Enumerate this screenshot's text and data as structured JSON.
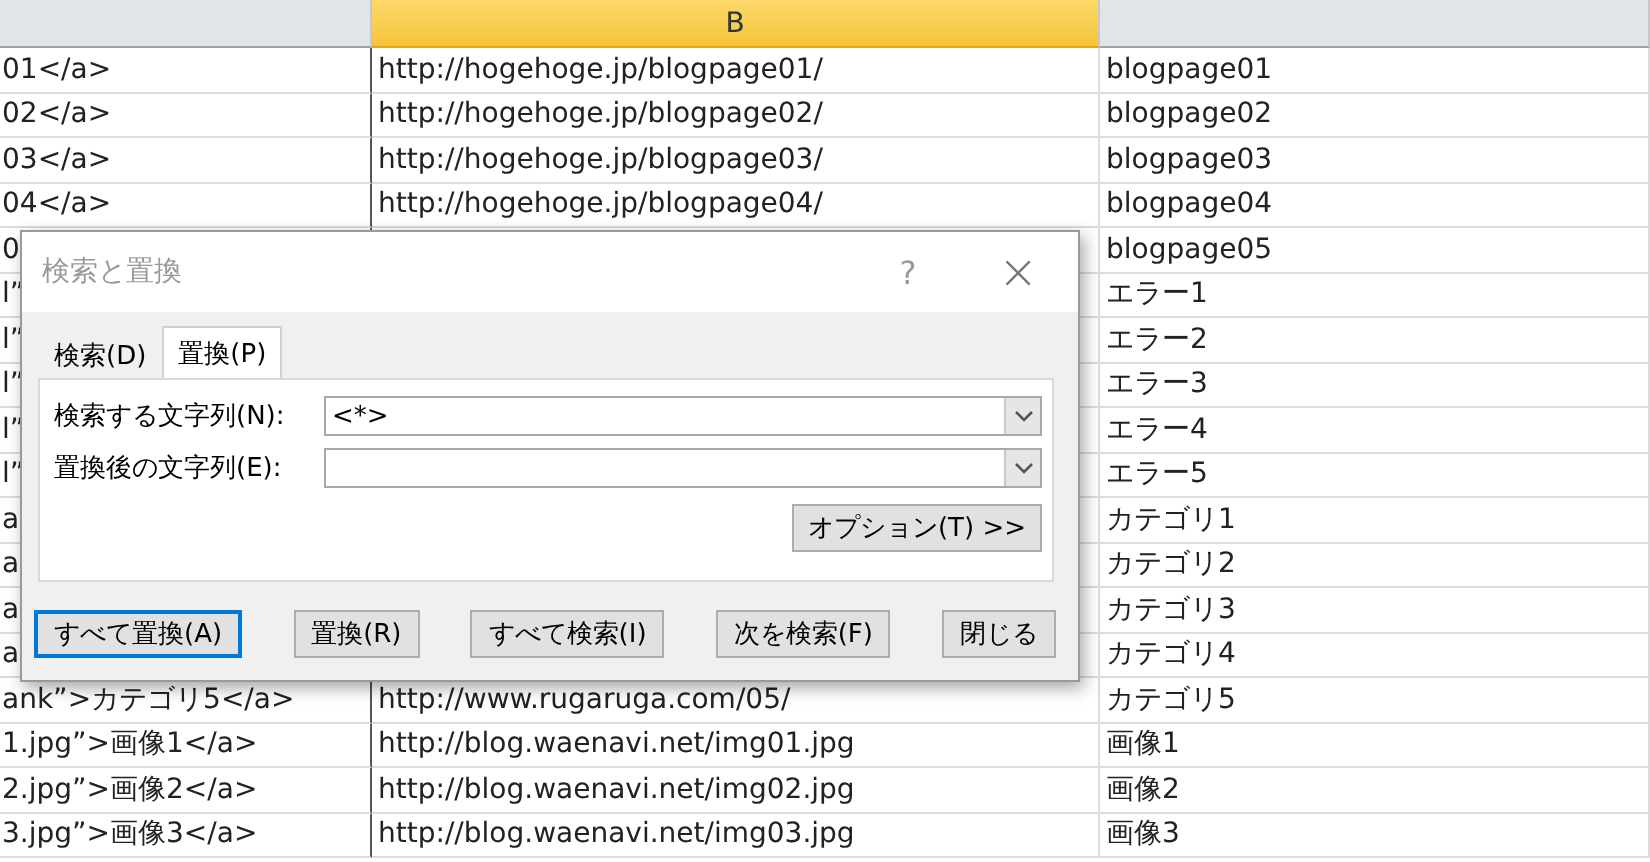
{
  "columns": [
    {
      "selected": false
    },
    {
      "label": "B",
      "selected": true
    },
    {
      "selected": false
    }
  ],
  "rows": [
    {
      "a": "01</a>",
      "b": "http://hogehoge.jp/blogpage01/",
      "c": "blogpage01"
    },
    {
      "a": "02</a>",
      "b": "http://hogehoge.jp/blogpage02/",
      "c": "blogpage02"
    },
    {
      "a": "03</a>",
      "b": "http://hogehoge.jp/blogpage03/",
      "c": "blogpage03"
    },
    {
      "a": "04</a>",
      "b": "http://hogehoge.jp/blogpage04/",
      "c": "blogpage04"
    },
    {
      "a": "0",
      "c": "blogpage05"
    },
    {
      "a": "l”",
      "c": "エラー1"
    },
    {
      "a": "l”",
      "c": "エラー2"
    },
    {
      "a": "l”",
      "c": "エラー3"
    },
    {
      "a": "l”",
      "c": "エラー4"
    },
    {
      "a": "l”",
      "c": "エラー5"
    },
    {
      "a": "a",
      "c": "カテゴリ1"
    },
    {
      "a": "a",
      "c": "カテゴリ2"
    },
    {
      "a": "a",
      "c": "カテゴリ3"
    },
    {
      "a": "a",
      "c": "カテゴリ4"
    },
    {
      "a": "ank”>カテゴリ5</a>",
      "b": "http://www.rugaruga.com/05/",
      "c": "カテゴリ5"
    },
    {
      "a": "1.jpg”>画像1</a>",
      "b": "http://blog.waenavi.net/img01.jpg",
      "c": "画像1"
    },
    {
      "a": "2.jpg”>画像2</a>",
      "b": "http://blog.waenavi.net/img02.jpg",
      "c": "画像2"
    },
    {
      "a": "3.jpg”>画像3</a>",
      "b": "http://blog.waenavi.net/img03.jpg",
      "c": "画像3"
    }
  ],
  "dialog": {
    "title": "検索と置換",
    "help": "?",
    "close": "×",
    "tabs": [
      {
        "label": "検索(D)",
        "selected": false
      },
      {
        "label": "置換(P)",
        "selected": true
      }
    ],
    "fields": [
      {
        "label": "検索する文字列(N):",
        "value": "<*>"
      },
      {
        "label": "置換後の文字列(E):"
      }
    ],
    "options_button": "オプション(T) >>",
    "buttons": [
      {
        "label": "すべて置換(A)",
        "focused": true
      },
      {
        "label": "置換(R)",
        "focused": false
      },
      {
        "label": "すべて検索(I)",
        "focused": false
      },
      {
        "label": "次を検索(F)",
        "focused": false
      },
      {
        "label": "閉じる",
        "focused": false
      }
    ]
  }
}
